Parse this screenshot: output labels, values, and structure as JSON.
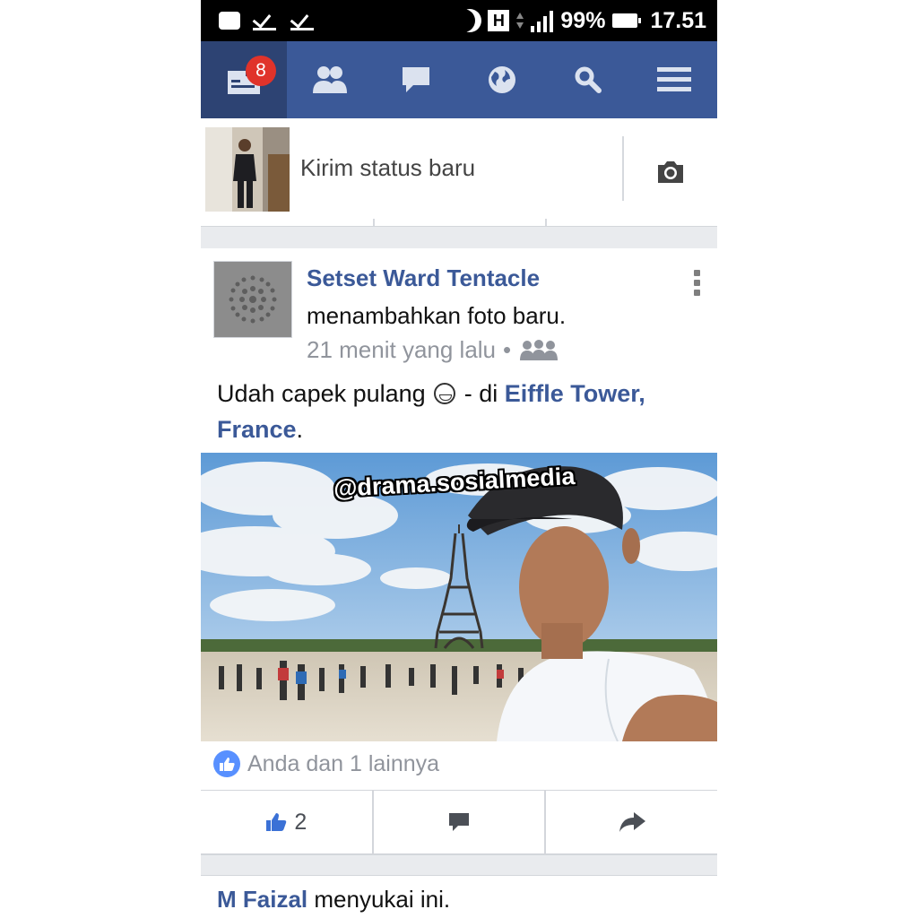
{
  "status_bar": {
    "battery": "99%",
    "time": "17.51"
  },
  "nav": {
    "notification_count": "8",
    "items": [
      "news-feed",
      "friends",
      "messages",
      "notifications",
      "search",
      "menu"
    ]
  },
  "composer": {
    "placeholder": "Kirim status baru"
  },
  "post": {
    "author": "Setset Ward Tentacle",
    "action": "menambahkan foto baru.",
    "time": "21 menit yang lalu",
    "separator": "•",
    "text_before": "Udah capek pulang",
    "text_middle": " - di ",
    "location": "Eiffle Tower, France",
    "text_after": ".",
    "photo_watermark": "@drama.sosialmedia",
    "likes_summary": "Anda dan 1 lainnya",
    "like_count": "2"
  },
  "next_story": {
    "name": "M Faizal",
    "action": " menyukai ini."
  },
  "colors": {
    "brand": "#3b5998",
    "nav_active": "#2d4373",
    "badge": "#e0332a",
    "like_blue": "#5890ff",
    "muted": "#90949c"
  }
}
